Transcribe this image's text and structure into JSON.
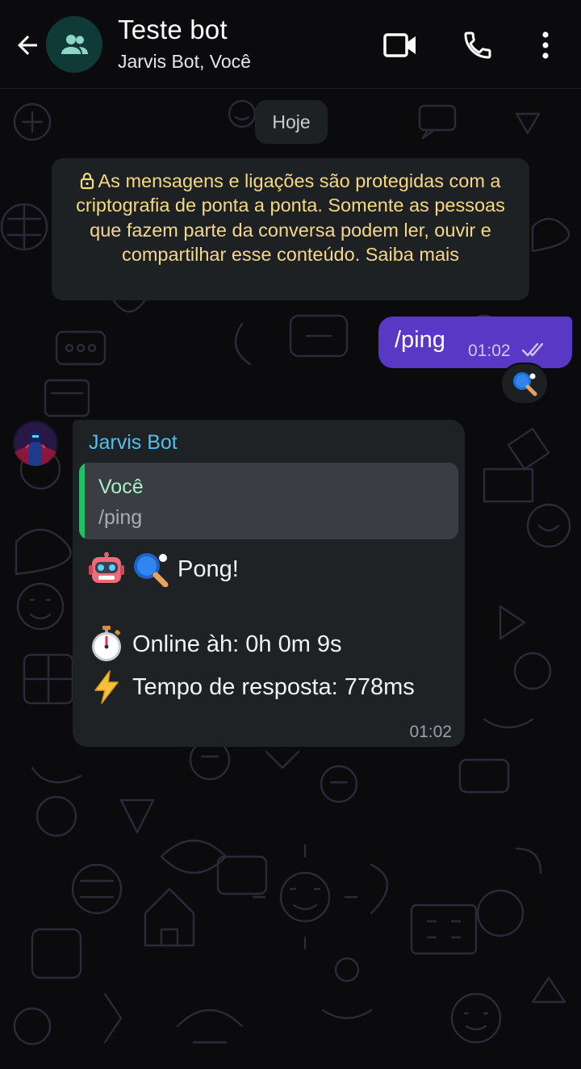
{
  "header": {
    "title": "Teste bot",
    "subtitle": "Jarvis Bot, Você",
    "icons": [
      "back-arrow-icon",
      "group-icon",
      "video-call-icon",
      "phone-icon",
      "more-vert-icon"
    ]
  },
  "chat": {
    "day_label": "Hoje",
    "e2e_notice": "As mensagens e ligações são protegidas com a criptografia de ponta a ponta. Somente as pessoas que fazem parte da conversa podem ler, ouvir e compartilhar esse conteúdo. Saiba mais",
    "outgoing": {
      "text": "/ping",
      "time": "01:02",
      "status": "read",
      "reaction_icon": "ping-pong-icon"
    },
    "incoming": {
      "sender": "Jarvis Bot",
      "quote_author": "Você",
      "quote_text": "/ping",
      "line1": "Pong!",
      "line2": "Online àh: 0h 0m 9s",
      "line3": "Tempo de resposta: 778ms",
      "time": "01:02"
    }
  },
  "colors": {
    "background": "#0b0b0d",
    "outgoing_bubble": "#5a38c6",
    "incoming_bubble": "#1f2225",
    "sender_name": "#53bdeb",
    "quote_accent": "#21c063",
    "notice_text": "#f6d884"
  }
}
